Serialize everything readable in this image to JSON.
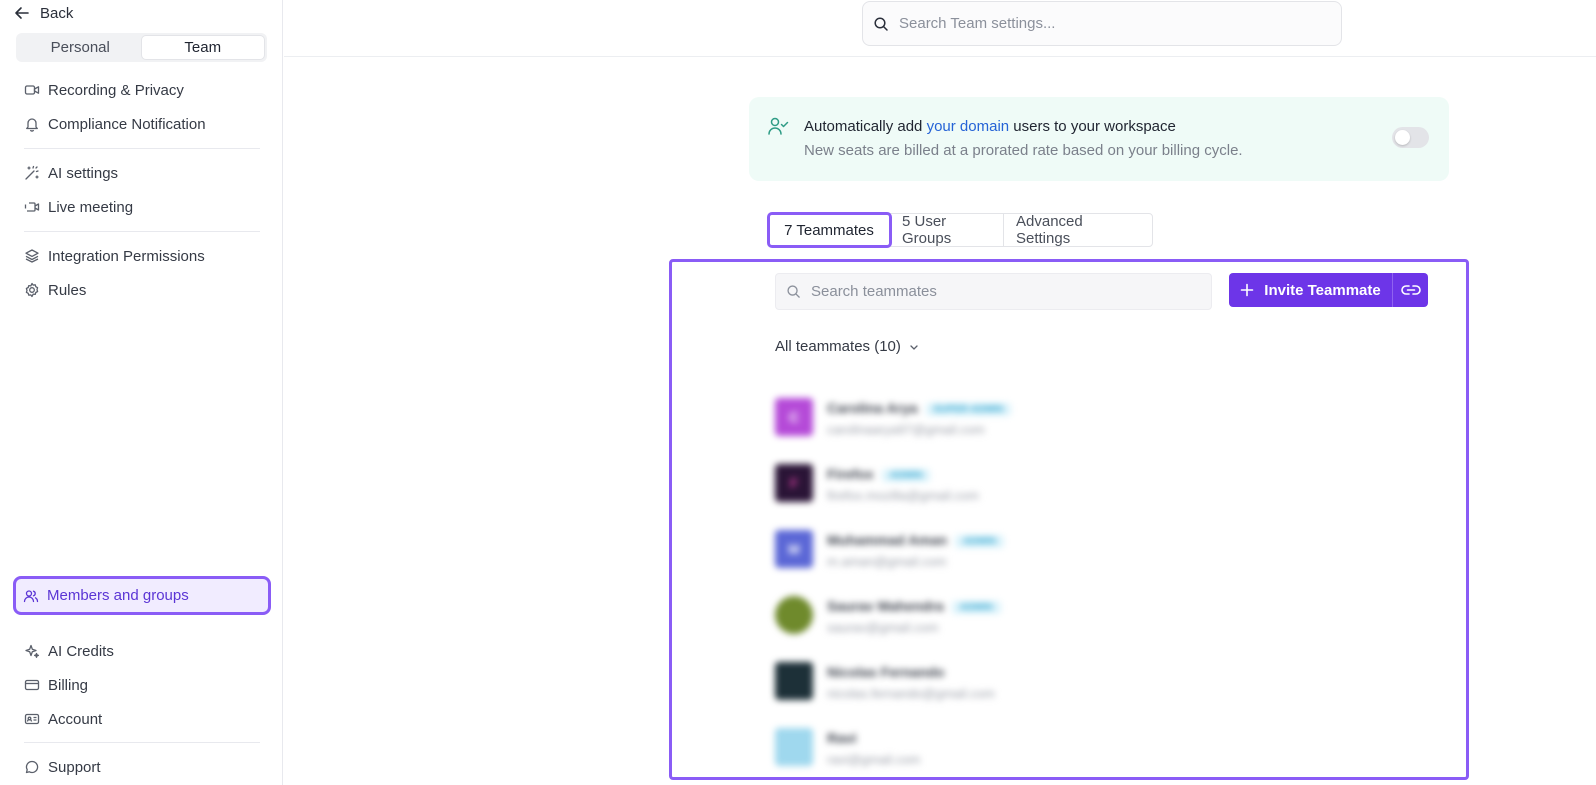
{
  "sidebar": {
    "back_label": "Back",
    "segments": {
      "personal": "Personal",
      "team": "Team"
    },
    "items": [
      {
        "label": "Recording & Privacy",
        "icon": "video-camera-icon"
      },
      {
        "label": "Compliance Notification",
        "icon": "bell-icon"
      },
      {
        "label": "AI settings",
        "icon": "magic-wand-icon"
      },
      {
        "label": "Live meeting",
        "icon": "live-video-icon"
      },
      {
        "label": "Integration Permissions",
        "icon": "layers-icon"
      },
      {
        "label": "Rules",
        "icon": "gear-icon"
      },
      {
        "label": "Members and groups",
        "icon": "users-icon",
        "selected": true
      },
      {
        "label": "AI Credits",
        "icon": "sparkles-icon"
      },
      {
        "label": "Billing",
        "icon": "credit-card-icon"
      },
      {
        "label": "Account",
        "icon": "id-card-icon"
      },
      {
        "label": "Support",
        "icon": "chat-bubble-icon"
      }
    ]
  },
  "header": {
    "search_placeholder": "Search Team settings..."
  },
  "banner": {
    "title_prefix": "Automatically add ",
    "title_link": "your domain",
    "title_suffix": " users to your workspace",
    "subtitle": "New seats are billed at a prorated rate based on your billing cycle.",
    "toggle_on": false
  },
  "tabs": [
    {
      "label": "7 Teammates",
      "active": true
    },
    {
      "label": "5 User Groups"
    },
    {
      "label": "Advanced Settings"
    }
  ],
  "members": {
    "search_placeholder": "Search teammates",
    "invite_label": "Invite Teammate",
    "filter_label": "All teammates (10)",
    "rows": [
      {
        "name": "Carolina Arya",
        "badge": "SUPER ADMIN",
        "email": "carolinaarya97@gmail.com",
        "initial": "C",
        "color": "#b54ad8"
      },
      {
        "name": "Firefox",
        "badge": "ADMIN",
        "email": "firefox.mozilla@gmail.com",
        "initial": "F",
        "color": "#2a1436"
      },
      {
        "name": "Muhammad Aman",
        "badge": "ADMIN",
        "email": "m.aman@gmail.com",
        "initial": "M",
        "color": "#5b67d6"
      },
      {
        "name": "Saurav Mahendra",
        "badge": "ADMIN",
        "email": "saurav@gmail.com",
        "initial": "",
        "color": "#6f8a2c"
      },
      {
        "name": "Nicolas Fernando",
        "badge": "",
        "email": "nicolas.fernando@gmail.com",
        "initial": "",
        "color": "#1d3038"
      },
      {
        "name": "Ravi",
        "badge": "",
        "email": "ravi@gmail.com",
        "initial": "",
        "color": "#9fd8ee"
      }
    ]
  },
  "colors": {
    "accent": "#6d35e8",
    "highlight": "#8a5cf6",
    "banner_bg": "#effbf7",
    "link": "#2563d6"
  }
}
